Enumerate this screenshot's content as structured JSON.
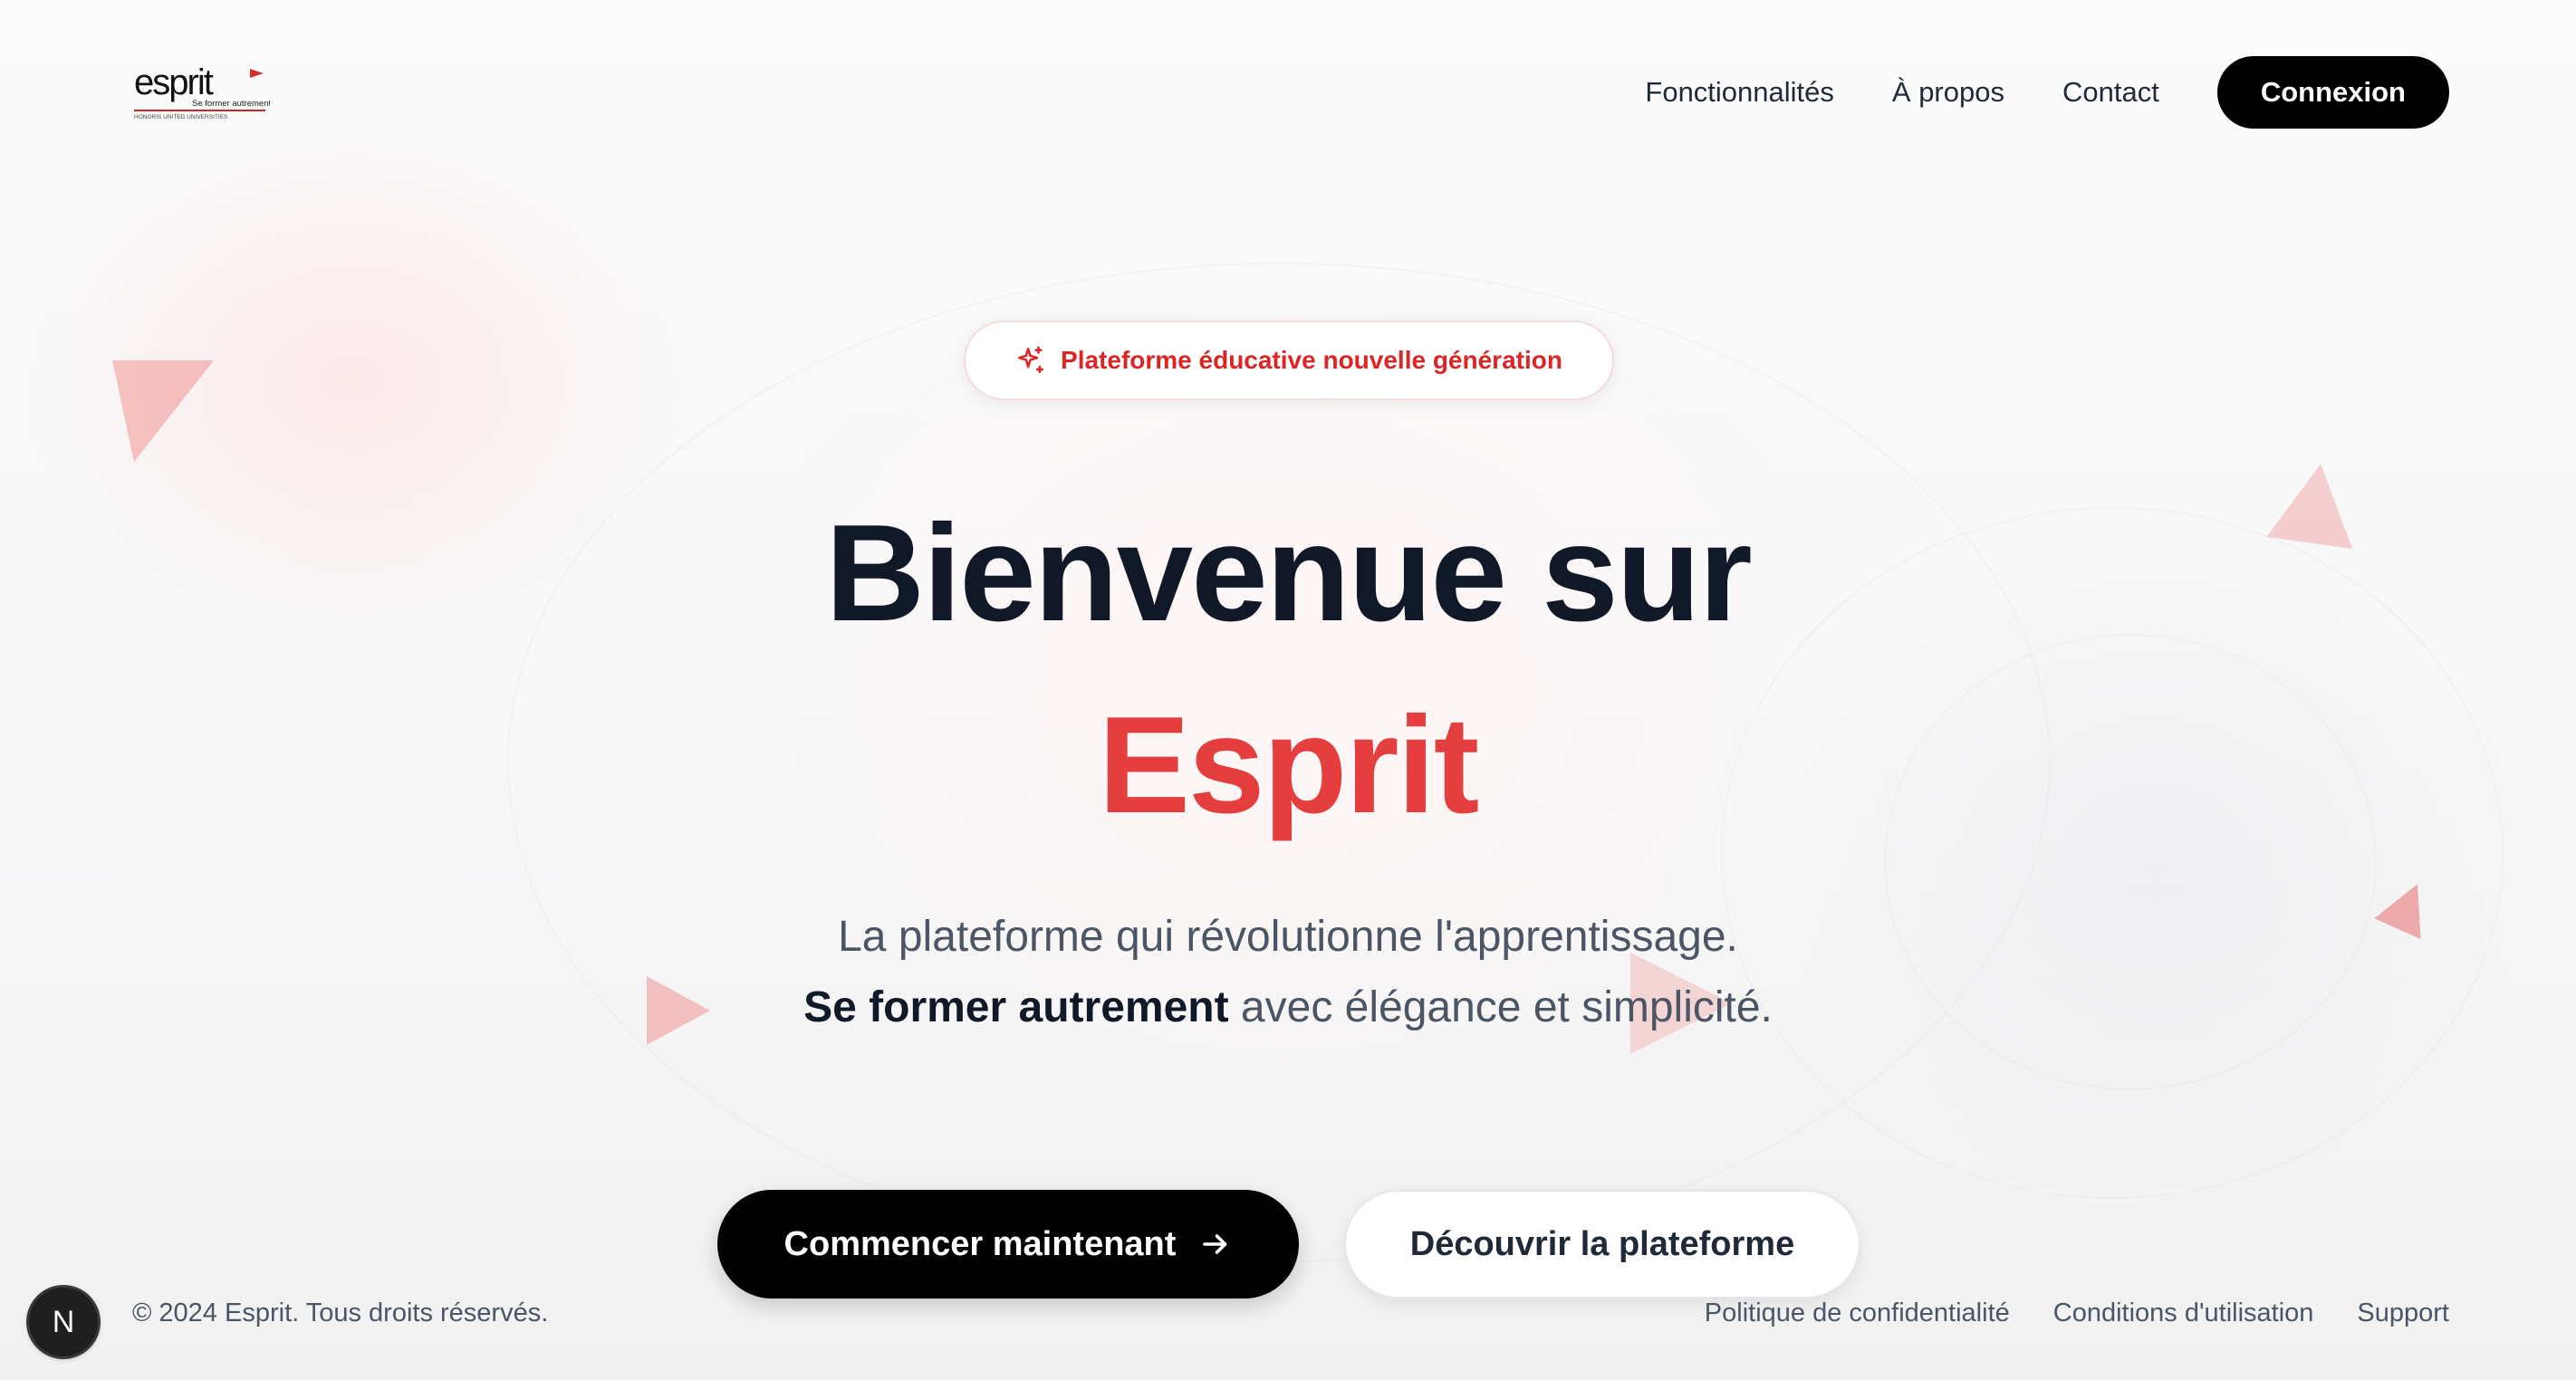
{
  "brand": {
    "logo_text": "esprit",
    "logo_tagline": "Se former autrement",
    "logo_subtext": "HONORIS UNITED UNIVERSITIES",
    "accent_color": "#e53e3e"
  },
  "nav": {
    "links": [
      {
        "label": "Fonctionnalités"
      },
      {
        "label": "À propos"
      },
      {
        "label": "Contact"
      }
    ],
    "login_label": "Connexion"
  },
  "badge": {
    "icon": "sparkles-icon",
    "label": "Plateforme éducative nouvelle génération"
  },
  "hero": {
    "headline_line1": "Bienvenue sur",
    "headline_line2": "Esprit",
    "subtitle_line1": "La plateforme qui révolutionne l'apprentissage.",
    "subtitle_emphasis": "Se former autrement",
    "subtitle_rest": "avec élégance et simplicité."
  },
  "cta": {
    "primary_label": "Commencer maintenant",
    "primary_icon": "arrow-right-icon",
    "secondary_label": "Découvrir la plateforme"
  },
  "footer": {
    "copyright": "© 2024 Esprit. Tous droits réservés.",
    "links": [
      {
        "label": "Politique de confidentialité"
      },
      {
        "label": "Conditions d'utilisation"
      },
      {
        "label": "Support"
      }
    ]
  },
  "dev_badge": {
    "label": "N",
    "icon": "nextjs-icon"
  }
}
